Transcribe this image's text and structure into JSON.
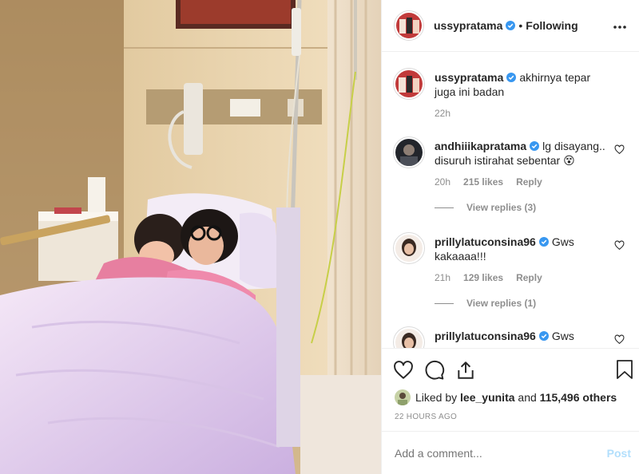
{
  "header": {
    "username": "ussypratama",
    "separator": "•",
    "follow_label": "Following"
  },
  "comments": [
    {
      "username": "ussypratama",
      "text": "akhirnya tepar juga ini badan",
      "time": "22h",
      "likes": "",
      "reply_label": "",
      "view_replies": ""
    },
    {
      "username": "andhiiikapratama",
      "text": "lg disayang.. disuruh istirahat sebentar 😵",
      "time": "20h",
      "likes": "215 likes",
      "reply_label": "Reply",
      "view_replies": "View replies (3)"
    },
    {
      "username": "prillylatuconsina96",
      "text": "Gws kakaaaa!!!",
      "time": "21h",
      "likes": "129 likes",
      "reply_label": "Reply",
      "view_replies": "View replies (1)"
    },
    {
      "username": "prillylatuconsina96",
      "text": "Gws",
      "time": "",
      "likes": "",
      "reply_label": "",
      "view_replies": ""
    }
  ],
  "likes": {
    "prefix": "Liked by",
    "user": "lee_yunita",
    "middle": "and",
    "count": "115,496 others"
  },
  "timestamp": "22 HOURS AGO",
  "add_comment": {
    "placeholder": "Add a comment...",
    "post_label": "Post"
  },
  "colors": {
    "verified": "#3897f0",
    "post_button": "#b2dffc",
    "muted": "#8e8e8e"
  },
  "icons": [
    "more-icon",
    "heart-icon",
    "comment-icon",
    "share-icon",
    "bookmark-icon",
    "verified-icon"
  ]
}
